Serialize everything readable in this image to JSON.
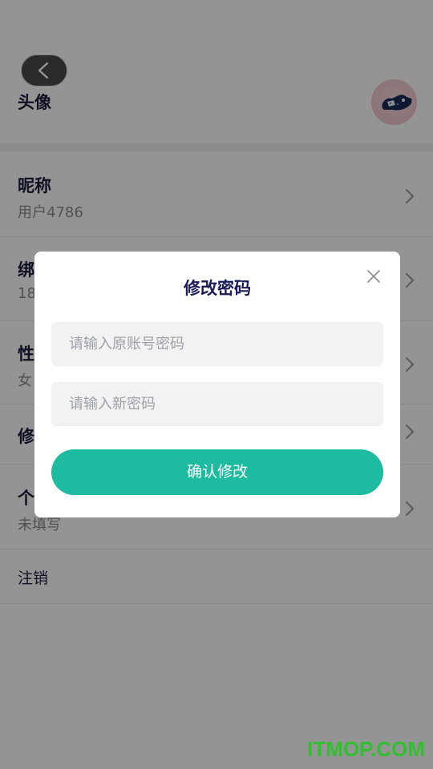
{
  "profile": {
    "avatar_label": "头像"
  },
  "rows": [
    {
      "title": "昵称",
      "value": "用户4786"
    },
    {
      "title": "绑",
      "value": "18"
    },
    {
      "title": "性",
      "value": "女"
    },
    {
      "title": "修",
      "value": ""
    },
    {
      "title": "个",
      "value": "未填写"
    }
  ],
  "cancel_account": "注销",
  "dialog": {
    "title": "修改密码",
    "old_password_placeholder": "请输入原账号密码",
    "new_password_placeholder": "请输入新密码",
    "confirm_label": "确认修改"
  },
  "icons": {
    "back": "chevron-left-icon",
    "close": "close-icon",
    "chevron": "chevron-right-icon"
  },
  "watermark": "ITMOP.COM",
  "colors": {
    "accent": "#1dbb9f",
    "title": "#1b1b5a",
    "watermark": "#2fbf2f"
  }
}
